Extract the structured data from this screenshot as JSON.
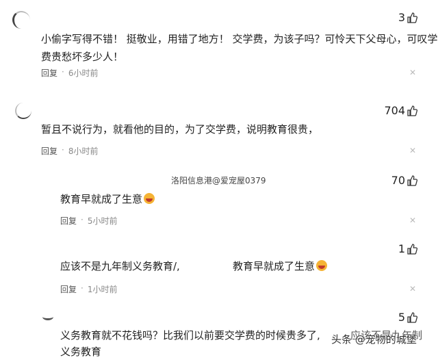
{
  "comments": [
    {
      "likes": "3",
      "text_lines": [
        "小偷字写得不错！ 挺敬业，用错了地方！ 交学费，为该子吗？可怜天下父母心，可叹学",
        "费贵愁坏多少人！"
      ],
      "reply": "回复",
      "time": "6小时前"
    },
    {
      "likes": "704",
      "text_lines": [
        "暂且不说行为，就看他的目的，为了交学费，说明教育很贵，"
      ],
      "reply": "回复",
      "time": "8小时前"
    },
    {
      "likes": "70",
      "text_lines": [
        "教育早就成了生意"
      ],
      "reply": "回复",
      "time": "5小时前"
    },
    {
      "likes": "1",
      "text_lines": [
        "应该不是九年制义务教育/,",
        "教育早就成了生意"
      ],
      "reply": "回复",
      "time": "1小时前"
    },
    {
      "likes": "5",
      "text_lines": [
        "义务教育就不花钱吗？比我们以前要交学费的时候贵多了,",
        "应该不是九年制",
        "义务教育"
      ]
    }
  ],
  "watermark": "洛阳信息港@爱宠屋0379",
  "corner_watermark": "头条 @宠物的城堡",
  "icons": {
    "like": "thumbs-up-icon",
    "close": "close-icon"
  }
}
